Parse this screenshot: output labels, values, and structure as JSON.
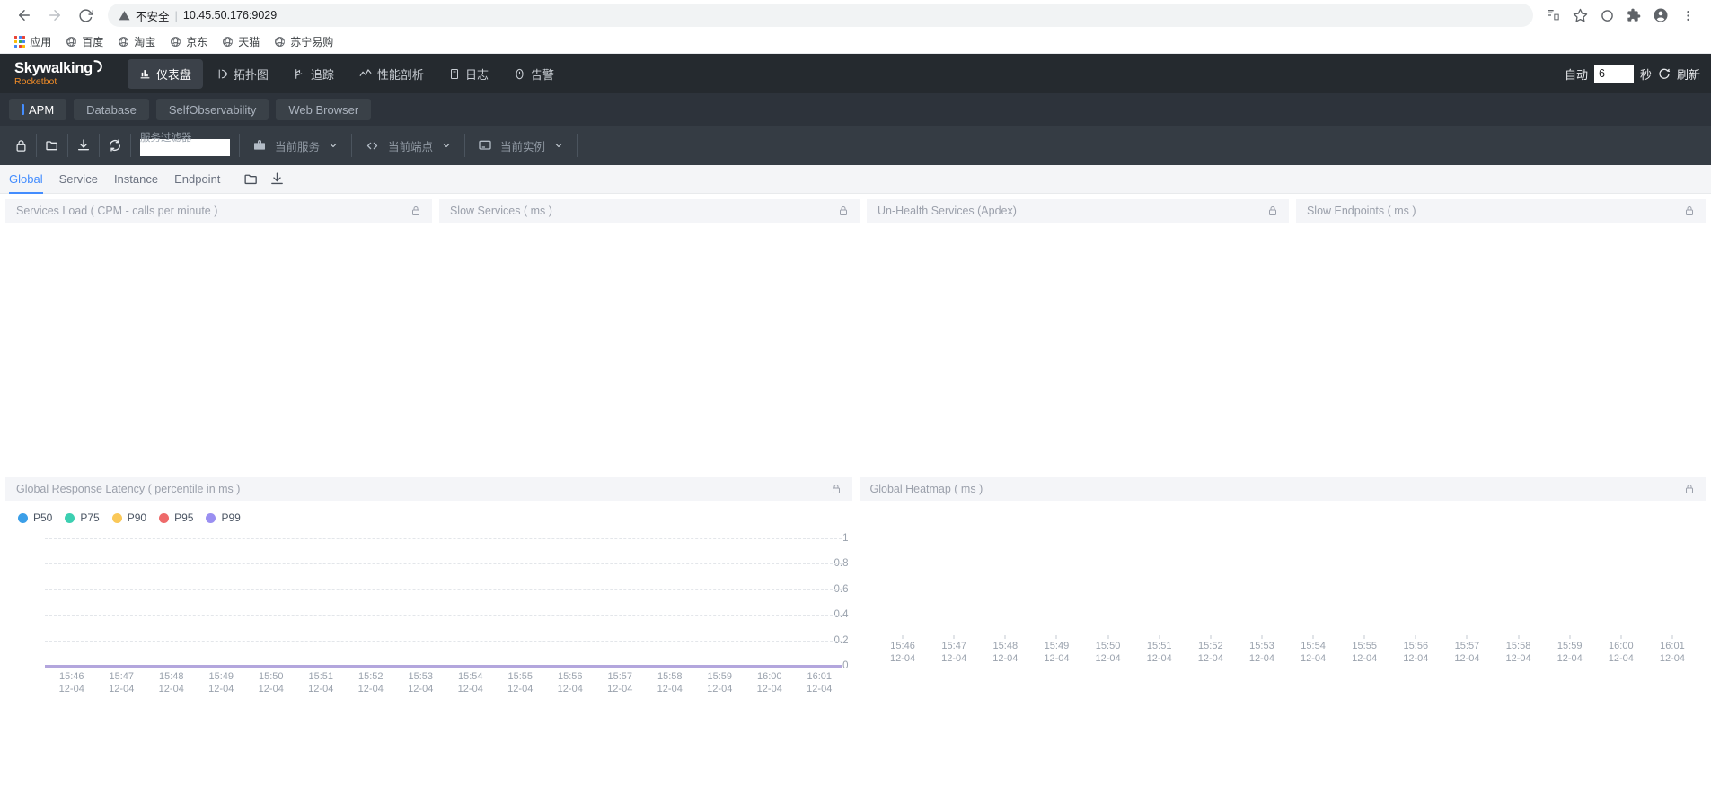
{
  "browser": {
    "back_icon": "back-arrow-icon",
    "forward_icon": "forward-arrow-icon",
    "reload_icon": "reload-icon",
    "security_warning": "不安全",
    "url": "10.45.50.176:9029",
    "right_icons": [
      "translate-icon",
      "bookmark-star-icon",
      "circle-icon",
      "extensions-puzzle-icon",
      "profile-avatar-icon",
      "kebab-menu-icon"
    ],
    "bookmarks": [
      {
        "label": "应用",
        "icon": "apps-grid-icon"
      },
      {
        "label": "百度",
        "icon": "globe-icon"
      },
      {
        "label": "淘宝",
        "icon": "globe-icon"
      },
      {
        "label": "京东",
        "icon": "globe-icon"
      },
      {
        "label": "天猫",
        "icon": "globe-icon"
      },
      {
        "label": "苏宁易购",
        "icon": "globe-icon"
      }
    ]
  },
  "app_header": {
    "logo_text": "Skywalking",
    "logo_sub": "Rocketbot",
    "nav": [
      {
        "label": "仪表盘",
        "icon": "dashboard-icon",
        "active": true
      },
      {
        "label": "拓扑图",
        "icon": "topology-icon",
        "active": false
      },
      {
        "label": "追踪",
        "icon": "trace-icon",
        "active": false
      },
      {
        "label": "性能剖析",
        "icon": "profiling-icon",
        "active": false
      },
      {
        "label": "日志",
        "icon": "log-icon",
        "active": false
      },
      {
        "label": "告警",
        "icon": "alarm-icon",
        "active": false
      }
    ],
    "refresh": {
      "auto_label": "自动",
      "interval_value": "6",
      "unit_label": "秒",
      "refresh_label": "刷新",
      "refresh_icon": "refresh-icon"
    }
  },
  "apm_tabs": [
    {
      "label": "APM",
      "active": true
    },
    {
      "label": "Database",
      "active": false
    },
    {
      "label": "SelfObservability",
      "active": false
    },
    {
      "label": "Web Browser",
      "active": false
    }
  ],
  "toolbar": {
    "icons": [
      "lock-icon",
      "folder-icon",
      "download-icon",
      "sync-icon"
    ],
    "filter_label": "服务过滤器",
    "filter_value": "",
    "selectors": [
      {
        "icon": "service-bag-icon",
        "label": "当前服务",
        "caret": "chevron-down-icon"
      },
      {
        "icon": "code-brackets-icon",
        "label": "当前端点",
        "caret": "chevron-down-icon"
      },
      {
        "icon": "instance-monitor-icon",
        "label": "当前实例",
        "caret": "chevron-down-icon"
      }
    ]
  },
  "subtabs": {
    "items": [
      {
        "label": "Global",
        "active": true
      },
      {
        "label": "Service",
        "active": false
      },
      {
        "label": "Instance",
        "active": false
      },
      {
        "label": "Endpoint",
        "active": false
      }
    ],
    "icons": [
      "folder-icon",
      "download-icon"
    ]
  },
  "widgets_row1": [
    {
      "title": "Services Load ( CPM - calls per minute )",
      "lock_icon": "lock-icon"
    },
    {
      "title": "Slow Services ( ms )",
      "lock_icon": "lock-icon"
    },
    {
      "title": "Un-Health Services (Apdex)",
      "lock_icon": "lock-icon"
    },
    {
      "title": "Slow Endpoints ( ms )",
      "lock_icon": "lock-icon"
    }
  ],
  "widgets_row2": [
    {
      "title": "Global Response Latency ( percentile in ms )",
      "lock_icon": "lock-icon"
    },
    {
      "title": "Global Heatmap ( ms )",
      "lock_icon": "lock-icon"
    }
  ],
  "colors": {
    "accent_blue": "#448dfe",
    "header_dark": "#252a2f",
    "apm_bar": "#2d333b",
    "sel_bar": "#353c44",
    "brand_orange": "#f08c28",
    "zero_line_purple": "#b3a6dd"
  },
  "chart_data": [
    {
      "type": "line",
      "title": "Global Response Latency ( percentile in ms )",
      "xlabel": "",
      "ylabel": "",
      "ylim": [
        0,
        1
      ],
      "yticks": [
        "0",
        "0.2",
        "0.4",
        "0.6",
        "0.8",
        "1"
      ],
      "grid": true,
      "legend_position": "top-left",
      "x": [
        "15:46\n12-04",
        "15:47\n12-04",
        "15:48\n12-04",
        "15:49\n12-04",
        "15:50\n12-04",
        "15:51\n12-04",
        "15:52\n12-04",
        "15:53\n12-04",
        "15:54\n12-04",
        "15:55\n12-04",
        "15:56\n12-04",
        "15:57\n12-04",
        "15:58\n12-04",
        "15:59\n12-04",
        "16:00\n12-04",
        "16:01\n12-04"
      ],
      "series": [
        {
          "name": "P50",
          "color": "#3b9fe8",
          "values": [
            0,
            0,
            0,
            0,
            0,
            0,
            0,
            0,
            0,
            0,
            0,
            0,
            0,
            0,
            0,
            0
          ]
        },
        {
          "name": "P75",
          "color": "#3ccfb1",
          "values": [
            0,
            0,
            0,
            0,
            0,
            0,
            0,
            0,
            0,
            0,
            0,
            0,
            0,
            0,
            0,
            0
          ]
        },
        {
          "name": "P90",
          "color": "#fac858",
          "values": [
            0,
            0,
            0,
            0,
            0,
            0,
            0,
            0,
            0,
            0,
            0,
            0,
            0,
            0,
            0,
            0
          ]
        },
        {
          "name": "P95",
          "color": "#ee6a6a",
          "values": [
            0,
            0,
            0,
            0,
            0,
            0,
            0,
            0,
            0,
            0,
            0,
            0,
            0,
            0,
            0,
            0
          ]
        },
        {
          "name": "P99",
          "color": "#9a8ff1",
          "values": [
            0,
            0,
            0,
            0,
            0,
            0,
            0,
            0,
            0,
            0,
            0,
            0,
            0,
            0,
            0,
            0
          ]
        }
      ]
    },
    {
      "type": "heatmap",
      "title": "Global Heatmap ( ms )",
      "xlabel": "",
      "ylabel": "",
      "grid": false,
      "x": [
        "15:46\n12-04",
        "15:47\n12-04",
        "15:48\n12-04",
        "15:49\n12-04",
        "15:50\n12-04",
        "15:51\n12-04",
        "15:52\n12-04",
        "15:53\n12-04",
        "15:54\n12-04",
        "15:55\n12-04",
        "15:56\n12-04",
        "15:57\n12-04",
        "15:58\n12-04",
        "15:59\n12-04",
        "16:00\n12-04",
        "16:01\n12-04"
      ],
      "values": []
    }
  ]
}
